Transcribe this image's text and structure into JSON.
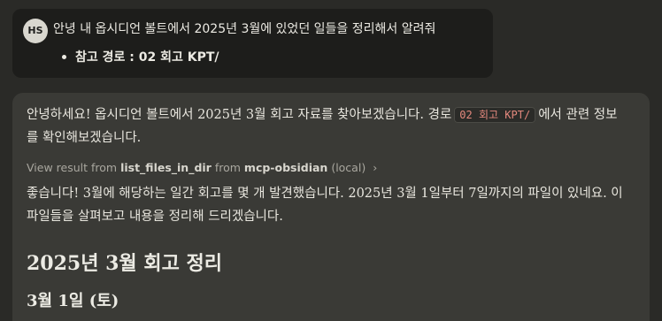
{
  "user_message": {
    "avatar_initials": "HS",
    "text": "안녕 내 옵시디언 볼트에서 2025년 3월에 있었던 일들을 정리해서 알려줘",
    "bullet": "참고 경로 : 02 회고 KPT/"
  },
  "assistant": {
    "intro_before_code": "안녕하세요! 옵시디언 볼트에서 2025년 3월 회고 자료를 찾아보겠습니다. 경로",
    "intro_code": "02 회고 KPT/",
    "intro_after_code": "에서 관련 정보를 확인해보겠습니다.",
    "tool_result": {
      "prefix": "View result from",
      "tool_name": "list_files_in_dir",
      "from_label": "from",
      "server_name": "mcp-obsidian",
      "server_scope": "(local)",
      "chevron": "›"
    },
    "found_paragraph": "좋습니다! 3월에 해당하는 일간 회고를 몇 개 발견했습니다. 2025년 3월 1일부터 7일까지의 파일이 있네요. 이 파일들을 살펴보고 내용을 정리해 드리겠습니다.",
    "heading_1": "2025년 3월 회고 정리",
    "heading_2": "3월 1일 (토)"
  }
}
